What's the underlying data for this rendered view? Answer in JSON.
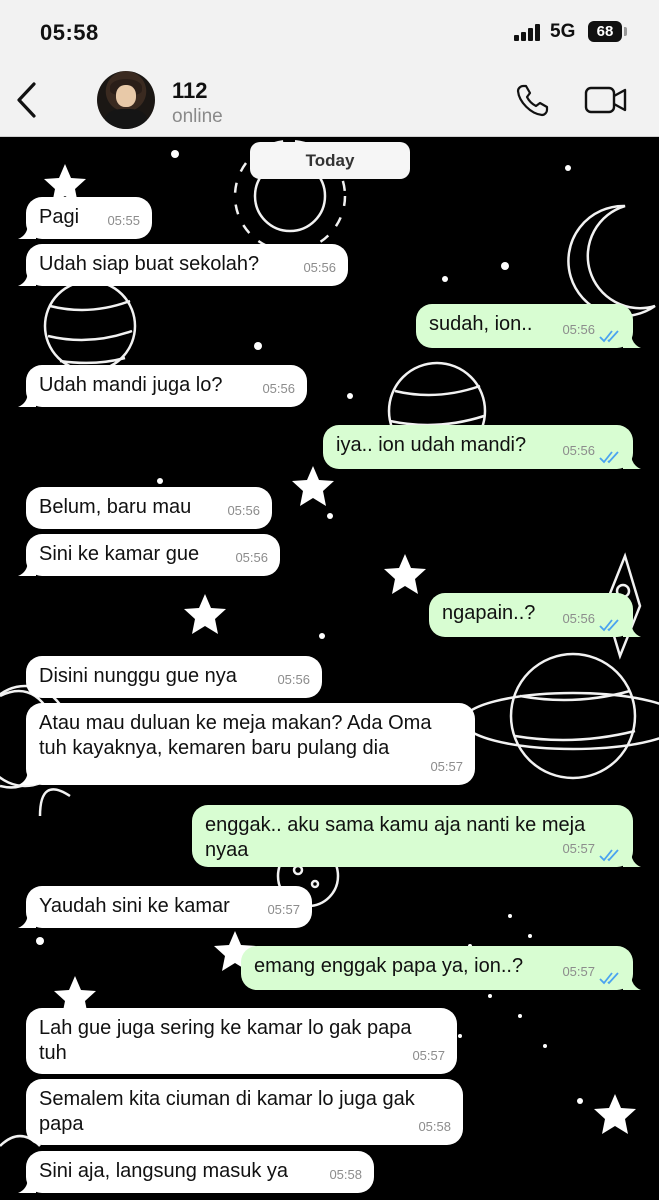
{
  "status_bar": {
    "time": "05:58",
    "network": "5G",
    "battery": "68"
  },
  "header": {
    "contact_name": "112",
    "contact_status": "online"
  },
  "date_divider": "Today",
  "colors": {
    "incoming": "#ffffff",
    "outgoing": "#d8fdd2",
    "tick": "#4aa3f0",
    "wallpaper": "#000000"
  },
  "messages": [
    {
      "text": "Pagi",
      "time": "05:55",
      "sender": "them"
    },
    {
      "text": "Udah siap buat sekolah?",
      "time": "05:56",
      "sender": "them"
    },
    {
      "text": "sudah, ion..",
      "time": "05:56",
      "sender": "me",
      "status": "read"
    },
    {
      "text": "Udah mandi juga lo?",
      "time": "05:56",
      "sender": "them"
    },
    {
      "text": "iya.. ion udah mandi?",
      "time": "05:56",
      "sender": "me",
      "status": "read"
    },
    {
      "text": "Belum, baru mau",
      "time": "05:56",
      "sender": "them"
    },
    {
      "text": "Sini ke kamar gue",
      "time": "05:56",
      "sender": "them"
    },
    {
      "text": "ngapain..?",
      "time": "05:56",
      "sender": "me",
      "status": "read"
    },
    {
      "text": "Disini nunggu gue nya",
      "time": "05:56",
      "sender": "them"
    },
    {
      "text": "Atau mau duluan ke meja makan? Ada Oma tuh kayaknya, kemaren baru pulang dia",
      "time": "05:57",
      "sender": "them"
    },
    {
      "text": "enggak.. aku sama kamu aja nanti ke meja nyaa",
      "time": "05:57",
      "sender": "me",
      "status": "read"
    },
    {
      "text": "Yaudah sini ke kamar",
      "time": "05:57",
      "sender": "them"
    },
    {
      "text": "emang enggak papa ya, ion..?",
      "time": "05:57",
      "sender": "me",
      "status": "read"
    },
    {
      "text": "Lah gue juga sering ke kamar lo gak papa tuh",
      "time": "05:57",
      "sender": "them"
    },
    {
      "text": "Semalem kita ciuman di kamar lo juga gak papa",
      "time": "05:58",
      "sender": "them"
    },
    {
      "text": "Sini aja, langsung masuk ya",
      "time": "05:58",
      "sender": "them"
    }
  ]
}
